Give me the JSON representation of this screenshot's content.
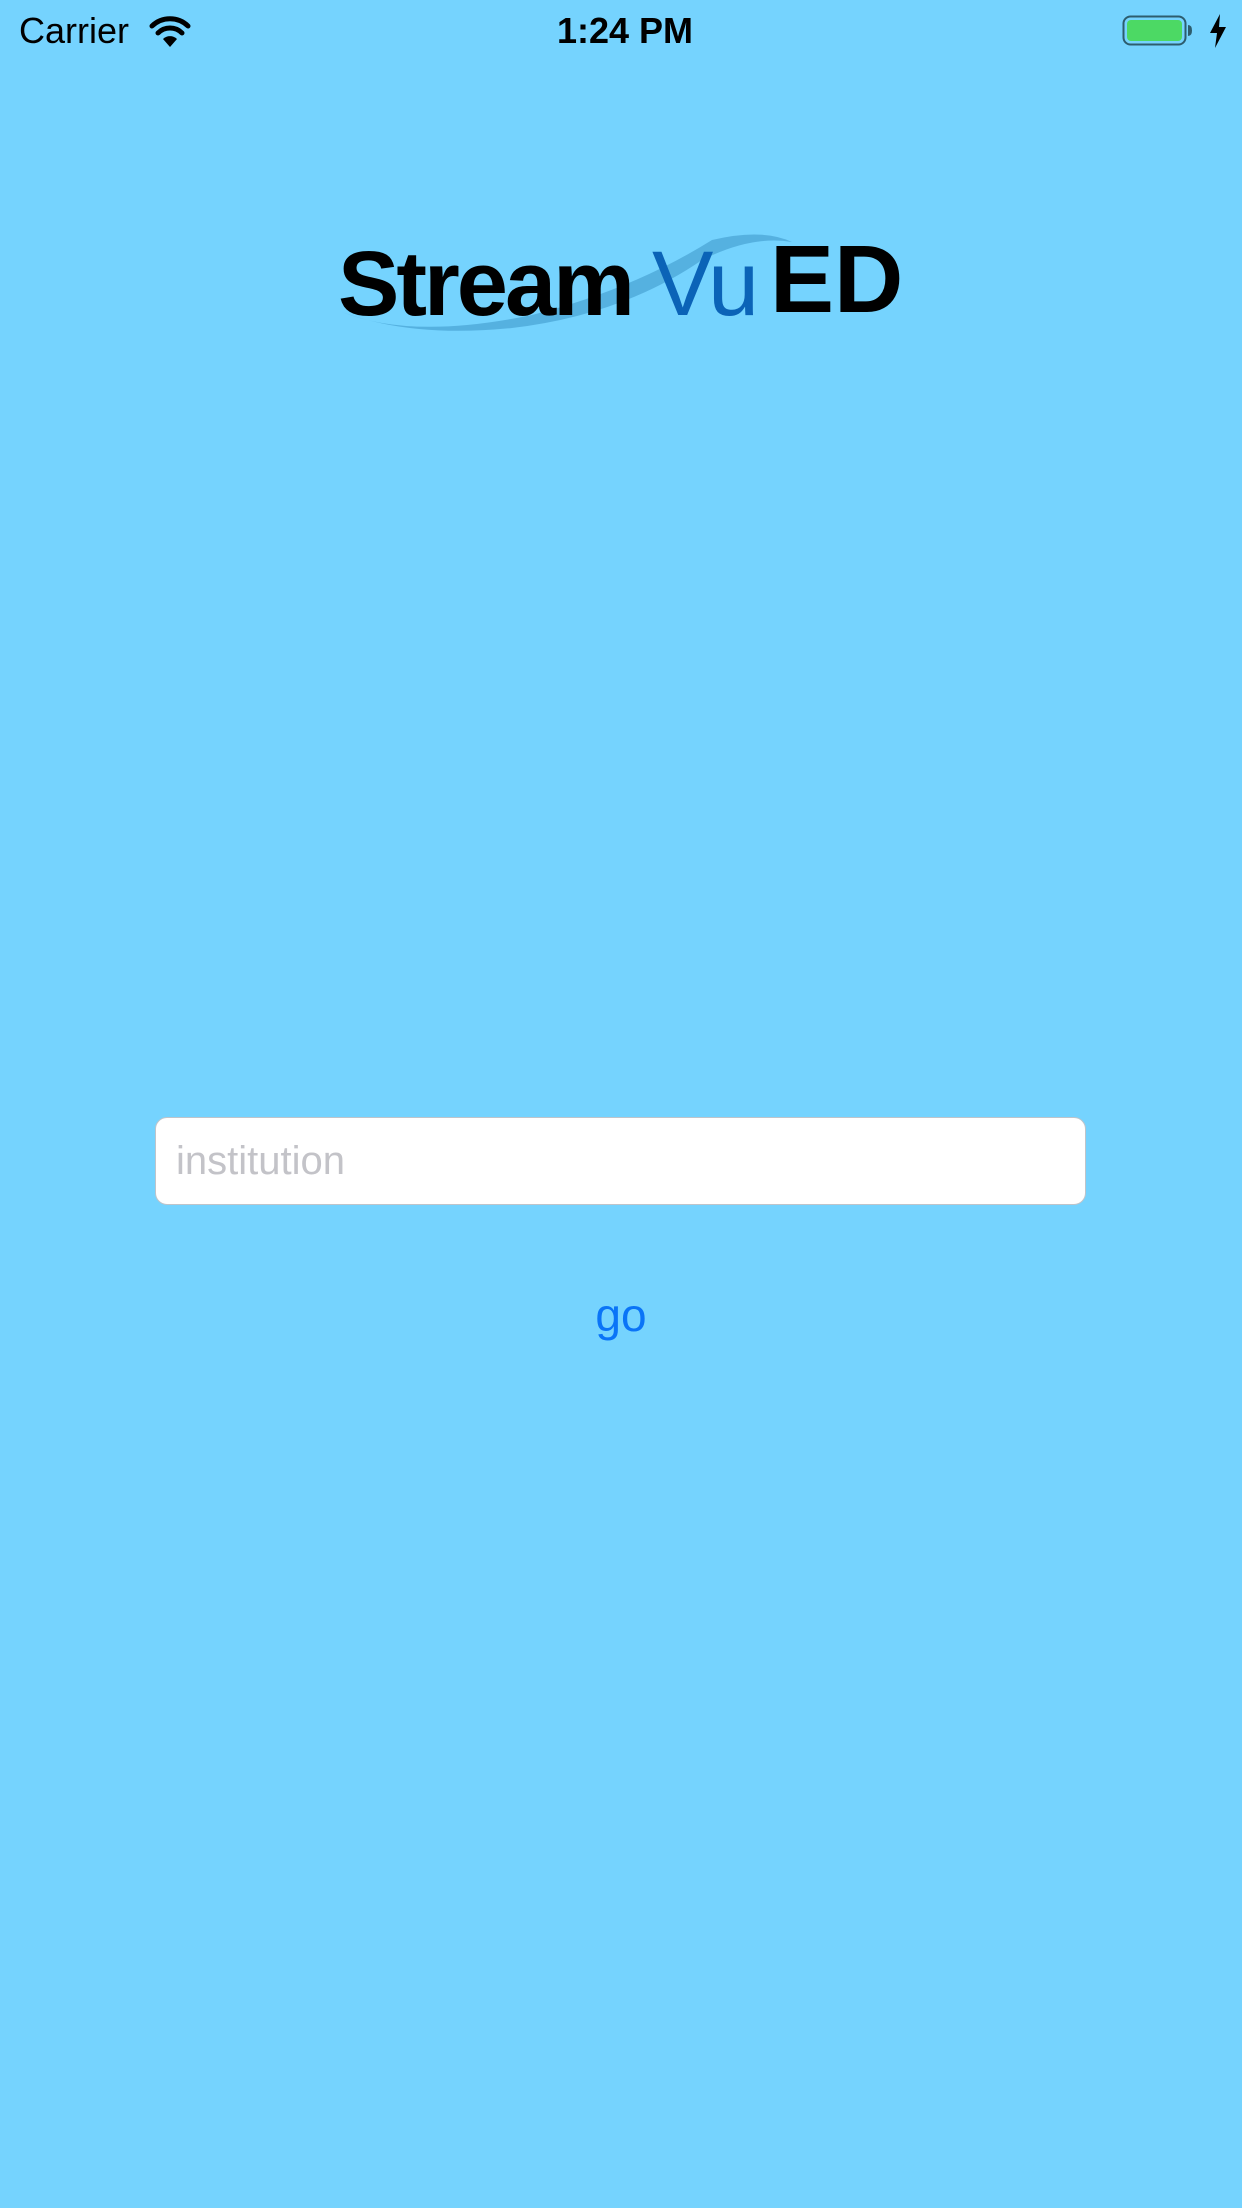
{
  "status_bar": {
    "carrier": "Carrier",
    "time": "1:24 PM",
    "wifi_icon": "wifi-icon",
    "battery_icon": "battery-icon",
    "charging_icon": "charging-bolt-icon",
    "battery_color": "#4cd964"
  },
  "logo": {
    "stream": "Stream",
    "vu": "Vu",
    "ed": "ED",
    "vu_color": "#0b63b7"
  },
  "form": {
    "institution_placeholder": "institution",
    "institution_value": "",
    "go_label": "go",
    "go_color": "#0a74f7"
  },
  "background_color": "#75d3fe"
}
